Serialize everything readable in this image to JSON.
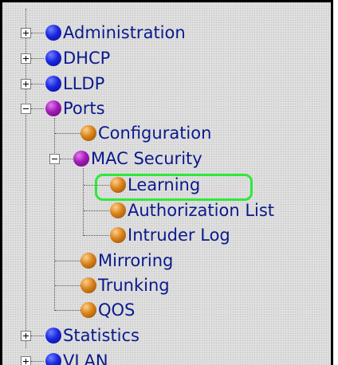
{
  "nav_tree": {
    "administration": "Administration",
    "dhcp": "DHCP",
    "lldp": "LLDP",
    "ports": "Ports",
    "ports_children": {
      "configuration": "Configuration",
      "mac_security": "MAC Security",
      "mac_security_children": {
        "learning": "Learning",
        "authorization_list": "Authorization List",
        "intruder_log": "Intruder Log"
      },
      "mirroring": "Mirroring",
      "trunking": "Trunking",
      "qos": "QOS"
    },
    "statistics": "Statistics",
    "vlan": "VLAN"
  },
  "colors": {
    "link_text": "#0a1a8c",
    "highlight": "#2ee83a",
    "folder_orb": "blue",
    "expanded_orb": "purple",
    "leaf_orb": "orange"
  }
}
